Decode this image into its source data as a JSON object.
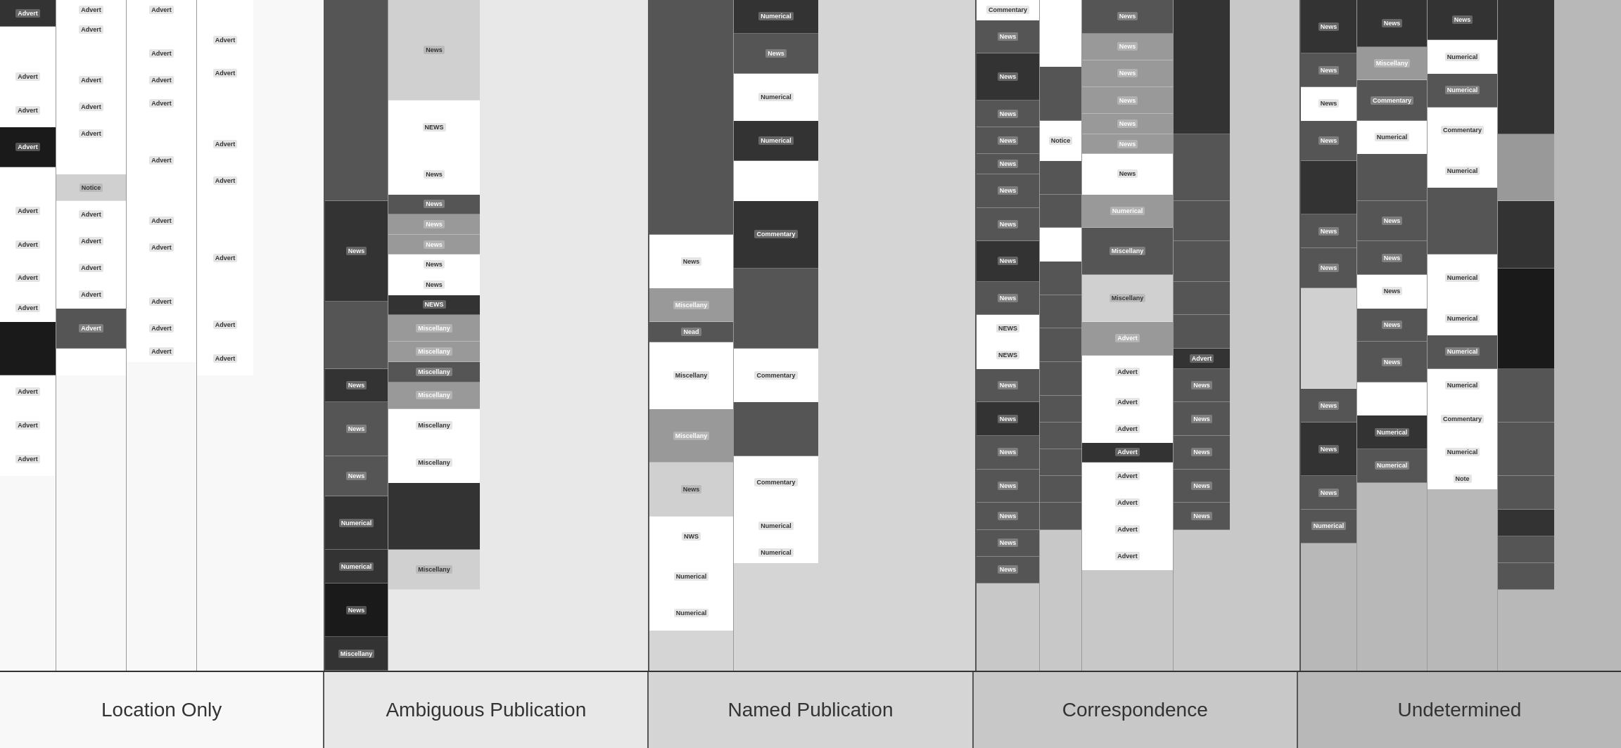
{
  "legend": {
    "items": [
      {
        "id": "location-only",
        "label": "Location Only"
      },
      {
        "id": "ambiguous-publication",
        "label": "Ambiguous Publication"
      },
      {
        "id": "named-publication",
        "label": "Named Publication"
      },
      {
        "id": "correspondence",
        "label": "Correspondence"
      },
      {
        "id": "undetermined",
        "label": "Undetermined"
      }
    ]
  },
  "groups": {
    "location_only": "Location Only",
    "ambiguous": "Ambiguous Publication",
    "named": "Named Publication",
    "correspondence": "Correspondence",
    "undetermined": "Undetermined"
  }
}
